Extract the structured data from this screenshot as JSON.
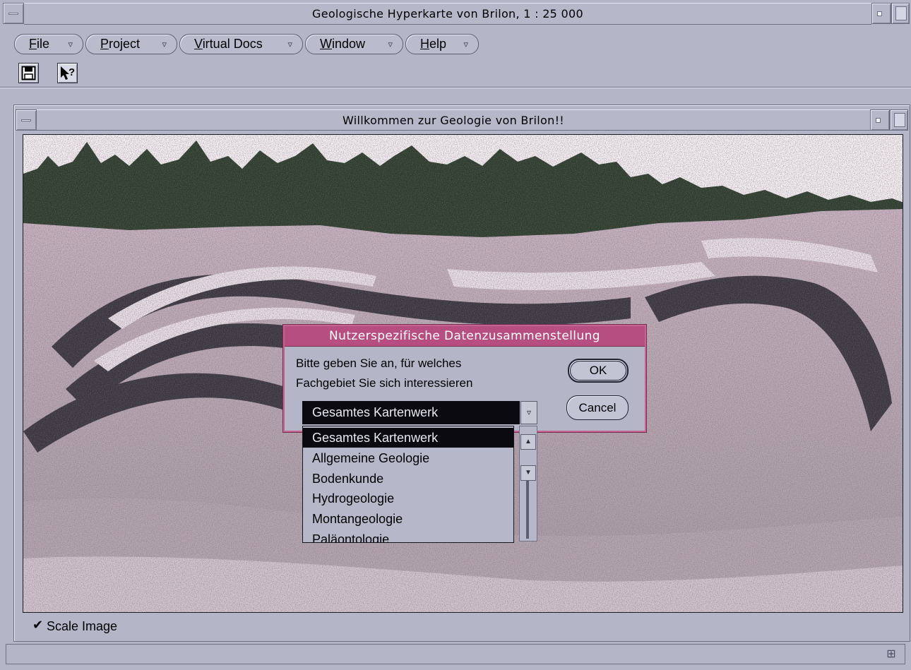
{
  "outer_window": {
    "title": "Geologische Hyperkarte von Brilon, 1 : 25 000"
  },
  "menubar": {
    "items": [
      {
        "mnemonic": "F",
        "rest": "ile"
      },
      {
        "mnemonic": "P",
        "rest": "roject"
      },
      {
        "mnemonic": "V",
        "rest": "irtual Docs"
      },
      {
        "mnemonic": "W",
        "rest": "indow"
      },
      {
        "mnemonic": "H",
        "rest": "elp"
      }
    ],
    "arrow_glyph": "▿"
  },
  "toolbar": {
    "save_icon": "floppy-disk-icon",
    "help_icon": "context-help-icon",
    "help_glyph": "?"
  },
  "inner_window": {
    "title": "Willkommen zur Geologie von Brilon!!"
  },
  "photo": {
    "description_icon": "quarry-photo",
    "colors": {
      "sky": "#fbf3f8",
      "dark": "#2c3a2c",
      "rock_light": "#e2c9da",
      "rock_dark": "#3a3340"
    }
  },
  "dialog": {
    "title": "Nutzerspezifische Datenzusammenstellung",
    "prompt_line1": "Bitte geben Sie an, für welches",
    "prompt_line2": "Fachgebiet Sie sich interessieren",
    "ok_label": "OK",
    "cancel_label": "Cancel",
    "combo_value": "Gesamtes Kartenwerk",
    "combo_arrow": "▿",
    "options": [
      "Gesamtes Kartenwerk",
      "Allgemeine Geologie",
      "Bodenkunde",
      "Hydrogeologie",
      "Montangeologie",
      "Paläontologie"
    ],
    "selected_index": 0,
    "accent_color": "#b74e82"
  },
  "footer": {
    "scale_checkbox_checked": true,
    "check_glyph": "✔",
    "scale_label": "Scale Image",
    "grip_glyph": "⊞"
  }
}
